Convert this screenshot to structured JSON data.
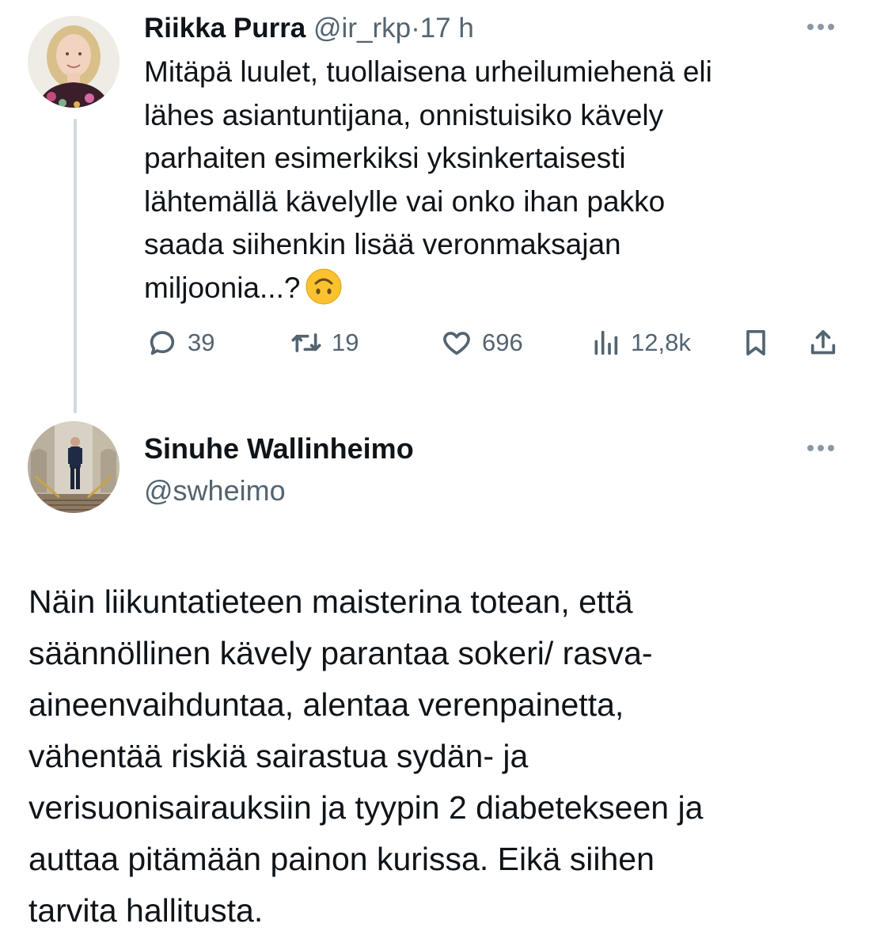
{
  "tweet1": {
    "author_name": "Riikka Purra",
    "handle": "@ir_rkp",
    "separator": "·",
    "time": "17 h",
    "text": "Mitäpä luulet, tuollaisena urheilumiehenä eli\nlähes asiantuntijana, onnistuisiko kävely\nparhaiten esimerkiksi yksinkertaisesti\nlähtemällä kävelylle vai onko ihan pakko\nsaada siihenkin lisää veronmaksajan\nmiljoonia...?",
    "emoji_icon": "upside-down-face-icon",
    "stats": {
      "replies": "39",
      "retweets": "19",
      "likes": "696",
      "views": "12,8k"
    },
    "icons": [
      "reply-icon",
      "retweet-icon",
      "like-icon",
      "views-icon",
      "bookmark-icon",
      "share-icon"
    ]
  },
  "tweet2": {
    "author_name": "Sinuhe Wallinheimo",
    "handle": "@swheimo",
    "text": "Näin liikuntatieteen maisterina totean, että\nsäännöllinen kävely parantaa sokeri/ rasva-\naineenvaihduntaa, alentaa verenpainetta,\nvähentää riskiä sairastua sydän- ja\nverisuonisairauksiin ja tyypin 2 diabetekseen ja\nauttaa pitämään painon kurissa. Eikä siihen\ntarvita hallitusta."
  },
  "colors": {
    "text_primary": "#0f1419",
    "text_secondary": "#536471",
    "thread_line": "#cfd9de",
    "more_dots": "#8b98a5",
    "emoji_fill": "#f9c22e"
  }
}
